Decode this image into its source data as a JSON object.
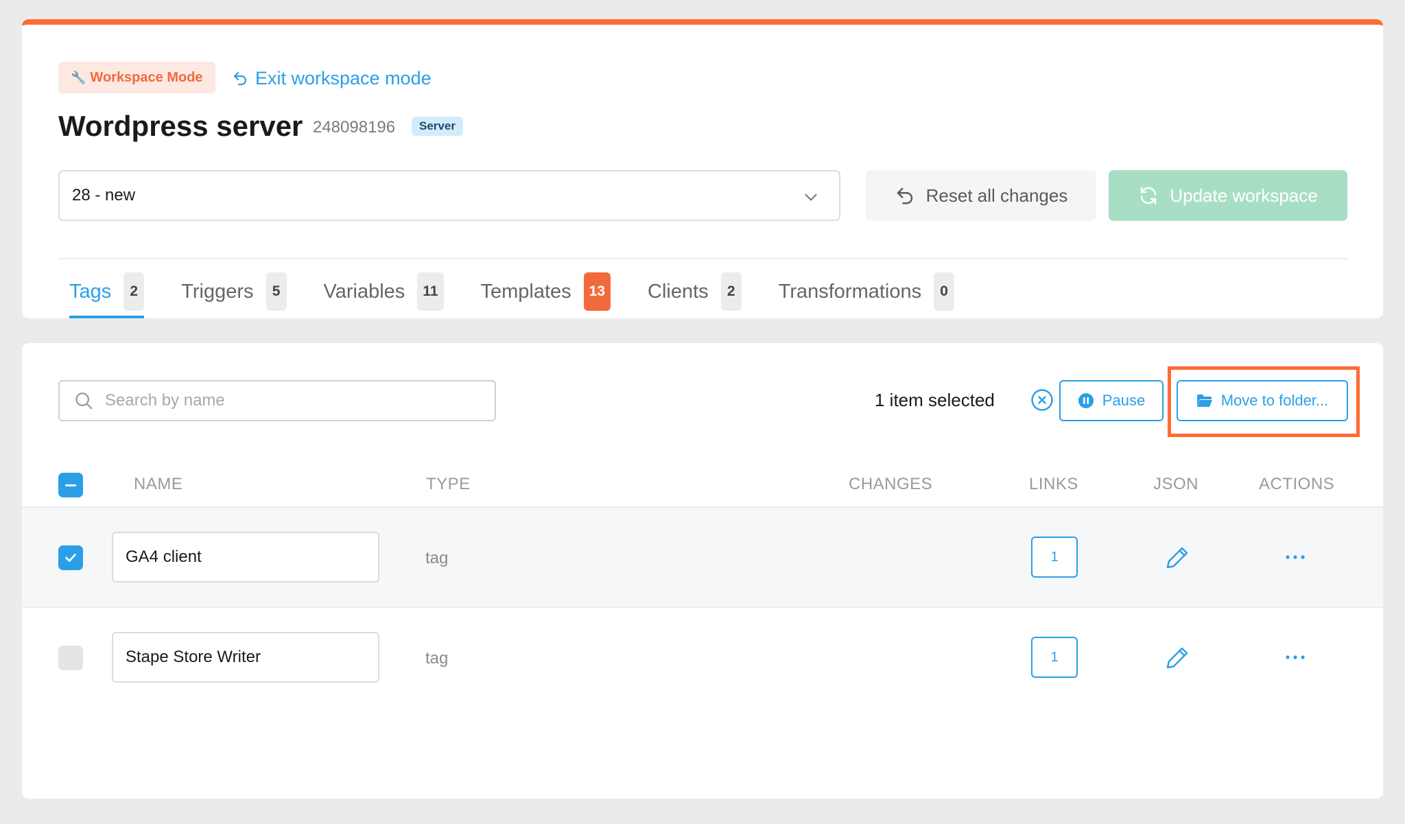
{
  "header": {
    "workspace_badge": "Workspace Mode",
    "exit_link": "Exit workspace mode",
    "title": "Wordpress server",
    "server_id": "248098196",
    "server_badge": "Server"
  },
  "workspace_select": {
    "value": "28 - new"
  },
  "actions": {
    "reset_label": "Reset all changes",
    "update_label": "Update workspace"
  },
  "tabs": [
    {
      "label": "Tags",
      "count": "2"
    },
    {
      "label": "Triggers",
      "count": "5"
    },
    {
      "label": "Variables",
      "count": "11"
    },
    {
      "label": "Templates",
      "count": "13"
    },
    {
      "label": "Clients",
      "count": "2"
    },
    {
      "label": "Transformations",
      "count": "0"
    }
  ],
  "toolbar": {
    "search_placeholder": "Search by name",
    "selection_text": "1 item selected",
    "pause_label": "Pause",
    "move_label": "Move to folder..."
  },
  "table": {
    "columns": [
      "NAME",
      "TYPE",
      "CHANGES",
      "LINKS",
      "JSON",
      "ACTIONS"
    ],
    "rows": [
      {
        "name": "GA4 client",
        "type": "tag",
        "links": "1",
        "checked": true
      },
      {
        "name": "Stape Store Writer",
        "type": "tag",
        "links": "1",
        "checked": false
      }
    ]
  },
  "colors": {
    "accent": "#2a9fe8",
    "brand_orange": "#ff6b35",
    "update_button": "#a8dfc4"
  },
  "icons": [
    "wrench-icon",
    "undo-icon",
    "chevron-down-icon",
    "refresh-icon",
    "search-icon",
    "close-circle-icon",
    "pause-icon",
    "folder-icon",
    "check-icon",
    "pencil-icon",
    "more-icon"
  ]
}
